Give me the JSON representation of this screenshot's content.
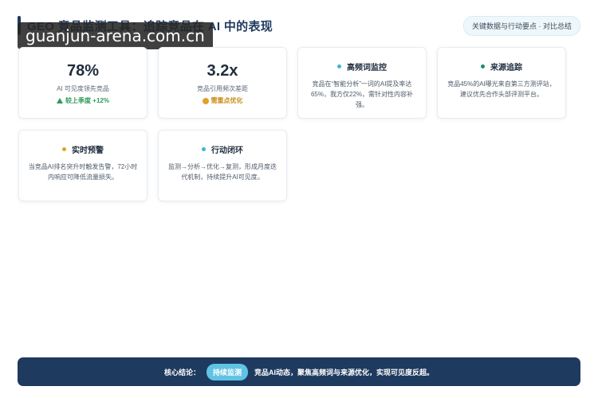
{
  "header": {
    "title": "GEO 竞品监测工具：追踪竞品在 AI 中的表现",
    "subtitle": "关键数据与行动要点 · 对比总结"
  },
  "watermark": "guanjun-arena.com.cn",
  "stats": [
    {
      "value": "78%",
      "label": "AI 可见度领先竞品",
      "note": "较上季度 +12%",
      "note_color": "#2e9a5b",
      "note_icon": "triangle-up-icon"
    },
    {
      "value": "3.2x",
      "label": "竞品引用频次差距",
      "note": "需重点优化",
      "note_color": "#c98a12",
      "note_icon": "warning-dot-icon"
    }
  ],
  "cards": [
    {
      "title": "高频词监控",
      "bullet_color": "#3fb6d3",
      "body": "竞品在“智能分析”一词的AI提及率达65%，我方仅22%，需针对性内容补强。"
    },
    {
      "title": "来源追踪",
      "bullet_color": "#1f8a6f",
      "body": "竞品45%的AI曝光来自第三方测评站，建议优先合作头部评测平台。"
    },
    {
      "title": "实时预警",
      "bullet_color": "#e0a12a",
      "body": "当竞品AI排名突升时触发告警，72小时内响应可降低流量损失。"
    },
    {
      "title": "行动闭环",
      "bullet_color": "#3fb6d3",
      "body": "监测→分析→优化→复测，形成月度迭代机制，持续提升AI可见度。"
    }
  ],
  "footer": {
    "lead": "核心结论：",
    "pill": "持续监测",
    "message": "竞品AI动态，聚焦高频词与来源优化，实现可见度反超。"
  }
}
